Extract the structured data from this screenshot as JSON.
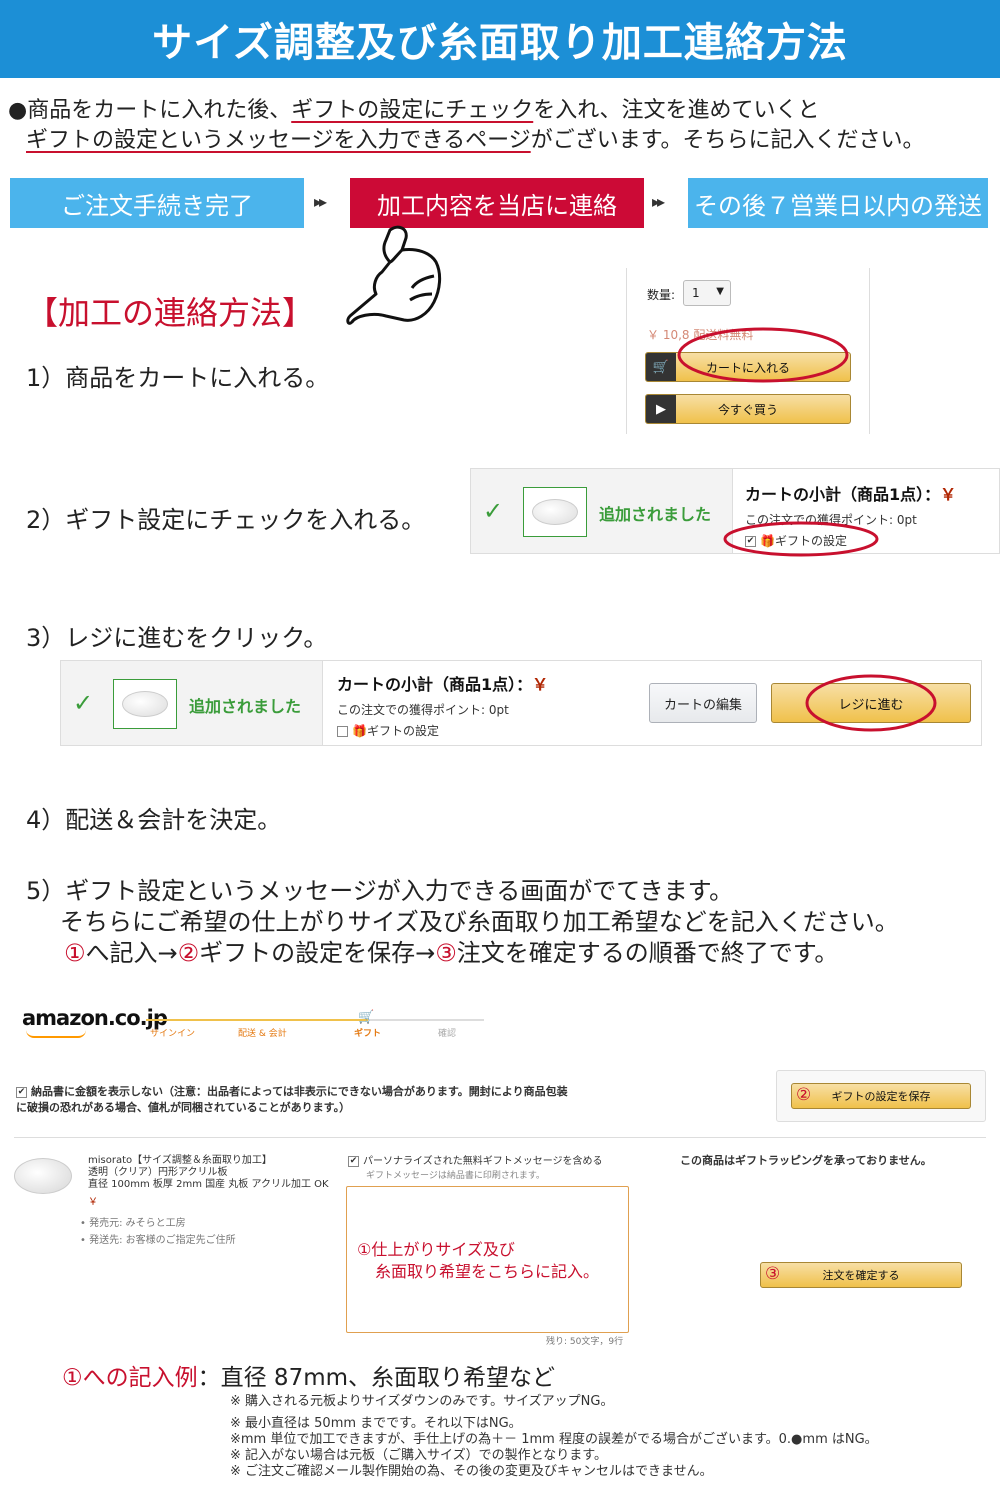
{
  "title": "サイズ調整及び糸面取り加工連絡方法",
  "intro": {
    "bullet": "●",
    "line1_a": "商品をカートに入れた後、",
    "line1_b": "ギフトの設定にチェック",
    "line1_c": "を入れ、注文を進めていくと",
    "line2_a": "ギフトの設定というメッセージを入力できるページ",
    "line2_b": "がございます。そちらに記入ください。"
  },
  "flow": [
    {
      "label": "ご注文手続き完了"
    },
    {
      "label": "加工内容を当店に連絡"
    },
    {
      "label": "その後７営業日以内の発送"
    }
  ],
  "flow_arrow": "▸▸",
  "section_title": "【加工の連絡方法】",
  "steps": {
    "s1": "1）商品をカートに入れる。",
    "s2": "2）ギフト設定にチェックを入れる。",
    "s3": "3）レジに進むをクリック。",
    "s4": "4）配送＆会計を決定。",
    "s5_line1": "5）ギフト設定というメッセージが入力できる画面がでてきます。",
    "s5_line2": "そちらにご希望の仕上がりサイズ及び糸面取り加工希望などを記入ください。",
    "s5_line3_a": "①",
    "s5_line3_b": "へ記入→",
    "s5_line3_c": "②",
    "s5_line3_d": "ギフトの設定を保存→",
    "s5_line3_e": "③",
    "s5_line3_f": "注文を確定するの順番で終了です。"
  },
  "panel1": {
    "qty_label": "数量:",
    "qty_value": "1",
    "price": "￥ 10,8",
    "price_tail": "配送料無料",
    "add_to_cart": "カートに入れる",
    "buy_now": "今すぐ買う"
  },
  "cart_panel": {
    "added": "追加されました",
    "subtotal": "カートの小計（商品1点）：",
    "yen": "￥",
    "points": "この注文での獲得ポイント: 0pt",
    "gift_setting": "ギフトの設定",
    "edit_cart": "カートの編集",
    "checkout": "レジに進む"
  },
  "amazon_page": {
    "logo": "amazon.co.jp",
    "progress": [
      "サインイン",
      "配送 & 会計",
      "ギフト",
      "確認"
    ],
    "hide_price_note_1": "納品書に金額を表示しない（注意：出品者によっては非表示にできない場合があります。開封により商品包装",
    "hide_price_note_2": "に破損の恐れがある場合、値札が同梱されていることがあります。）",
    "save_gift": "ギフトの設定を保存",
    "save_num": "②",
    "product_line1": "misorato【サイズ調整＆糸面取り加工】",
    "product_line2": "透明（クリア）円形アクリル板",
    "product_line3": "直径 100mm 板厚 2mm 国産 丸板 アクリル加工 OK",
    "product_price": "￥",
    "seller": "発売元: みそらと工房",
    "ship_to": "発送先: お客様のご指定先ご住所",
    "include_message": "パーソナライズされた無料ギフトメッセージを含める",
    "message_printed": "ギフトメッセージは納品書に印刷されます。",
    "message_hint_1": "①仕上がりサイズ及び",
    "message_hint_2": "糸面取り希望をこちらに記入。",
    "remaining": "残り: 50文字，9行",
    "no_wrapping": "この商品はギフトラッピングを承っておりません。",
    "confirm_num": "③",
    "confirm_order": "注文を確定する"
  },
  "example": {
    "label": "①への記入例",
    "colon": "：",
    "text": "直径 87mm、糸面取り希望など"
  },
  "notes": [
    "※ 購入される元板よりサイズダウンのみです。サイズアップNG。",
    "※ 最小直径は 50mm までです。それ以下はNG。",
    "※mm 単位で加工できますが、手仕上げの為＋－ 1mm 程度の誤差がでる場合がございます。0.●mm はNG。",
    "※ 記入がない場合は元板（ご購入サイズ）での製作となります。",
    "※ ご注文ご確認メール製作開始の為、その後の変更及びキャンセルはできません。"
  ],
  "colors": {
    "banner": "#1c8fd6",
    "flow_blue": "#4bb4ec",
    "flow_red": "#cc0a36",
    "accent_red": "#c8102e",
    "amazon_green": "#3a9c3a",
    "amazon_button": "#f0c14b"
  }
}
